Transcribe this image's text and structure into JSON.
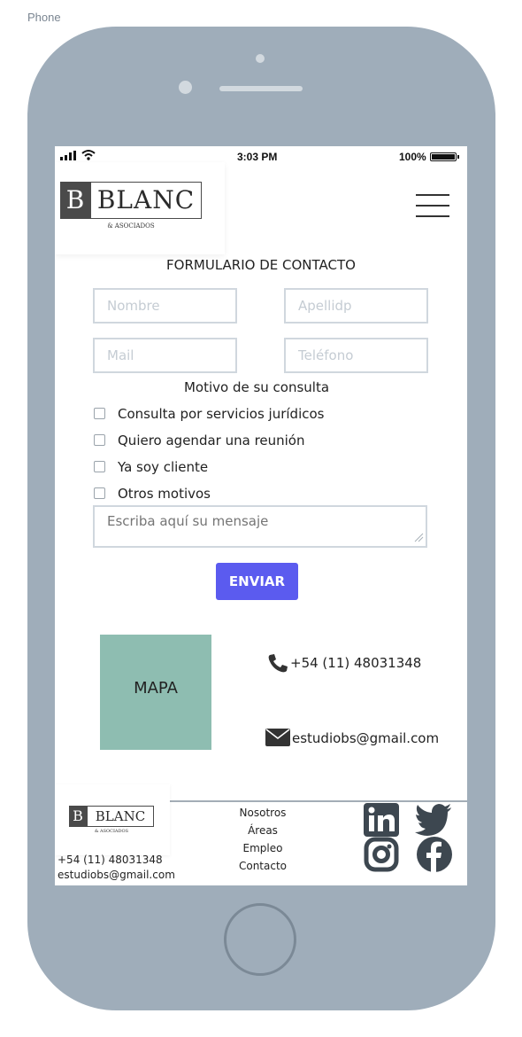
{
  "frame": {
    "label": "Phone"
  },
  "status_bar": {
    "time": "3:03 PM",
    "battery": "100%"
  },
  "header": {
    "logo": {
      "letter": "B",
      "name": "BLANC",
      "subtitle": "& ASOCIADOS"
    },
    "menu_icon": "hamburger-icon"
  },
  "form": {
    "title": "FORMULARIO DE CONTACTO",
    "fields": {
      "nombre": {
        "placeholder": "Nombre",
        "value": ""
      },
      "apellido": {
        "placeholder": "Apellidp",
        "value": ""
      },
      "mail": {
        "placeholder": "Mail",
        "value": ""
      },
      "telefono": {
        "placeholder": "Teléfono",
        "value": ""
      }
    },
    "motivo_title": "Motivo de su consulta",
    "options": [
      {
        "label": "Consulta por servicios jurídicos",
        "checked": false
      },
      {
        "label": "Quiero agendar una reunión",
        "checked": false
      },
      {
        "label": "Ya soy cliente",
        "checked": false
      },
      {
        "label": "Otros motivos",
        "checked": false
      }
    ],
    "message": {
      "placeholder": "Escriba aquí su mensaje",
      "value": ""
    },
    "submit_label": "ENVIAR",
    "accent_color": "#5b5bef"
  },
  "contact": {
    "map_label": "MAPA",
    "map_color": "#8ebdb1",
    "phone": "+54 (11) 48031348",
    "email": "estudiobs@gmail.com"
  },
  "footer": {
    "logo": {
      "letter": "B",
      "name": "BLANC",
      "subtitle": "& ASOCIADOS"
    },
    "phone": "+54 (11) 48031348",
    "email": "estudiobs@gmail.com",
    "nav": [
      "Nosotros",
      "Áreas",
      "Empleo",
      "Contacto"
    ],
    "social_icons": [
      "linkedin-icon",
      "twitter-icon",
      "instagram-icon",
      "facebook-icon"
    ]
  }
}
